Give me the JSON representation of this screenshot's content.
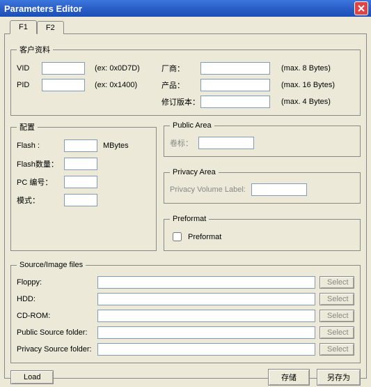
{
  "window": {
    "title": "Parameters Editor"
  },
  "tabs": {
    "f1": "F1",
    "f2": "F2"
  },
  "customer": {
    "legend": "客户资料",
    "vid_label": "VID",
    "vid_value": "",
    "vid_hint": "(ex: 0x0D7D)",
    "pid_label": "PID",
    "pid_value": "",
    "pid_hint": "(ex: 0x1400)",
    "vendor_label": "厂商：",
    "vendor_value": "",
    "vendor_hint": "(max. 8 Bytes)",
    "product_label": "产品：",
    "product_value": "",
    "product_hint": "(max. 16 Bytes)",
    "revision_label": "修订版本：",
    "revision_value": "",
    "revision_hint": "(max. 4 Bytes)"
  },
  "config": {
    "legend": "配置",
    "flash_label": "Flash :",
    "flash_value": "",
    "flash_unit": "MBytes",
    "flash_count_label": "Flash数量：",
    "flash_count_value": "",
    "pc_num_label": "PC 编号：",
    "pc_num_value": "",
    "mode_label": "模式：",
    "mode_value": ""
  },
  "public_area": {
    "legend": "Public Area",
    "volume_label": "卷标：",
    "volume_value": ""
  },
  "privacy_area": {
    "legend": "Privacy Area",
    "volume_label": "Privacy Volume Label:",
    "volume_value": ""
  },
  "preformat": {
    "legend": "Preformat",
    "checkbox_label": "Preformat",
    "checked": false
  },
  "source": {
    "legend": "Source/Image files",
    "floppy_label": "Floppy:",
    "floppy_value": "",
    "hdd_label": "HDD:",
    "hdd_value": "",
    "cdrom_label": "CD-ROM:",
    "cdrom_value": "",
    "public_src_label": "Public Source folder:",
    "public_src_value": "",
    "privacy_src_label": "Privacy Source folder:",
    "privacy_src_value": "",
    "select_btn": "Select"
  },
  "buttons": {
    "load": "Load",
    "save": "存储",
    "save_as": "另存为"
  }
}
